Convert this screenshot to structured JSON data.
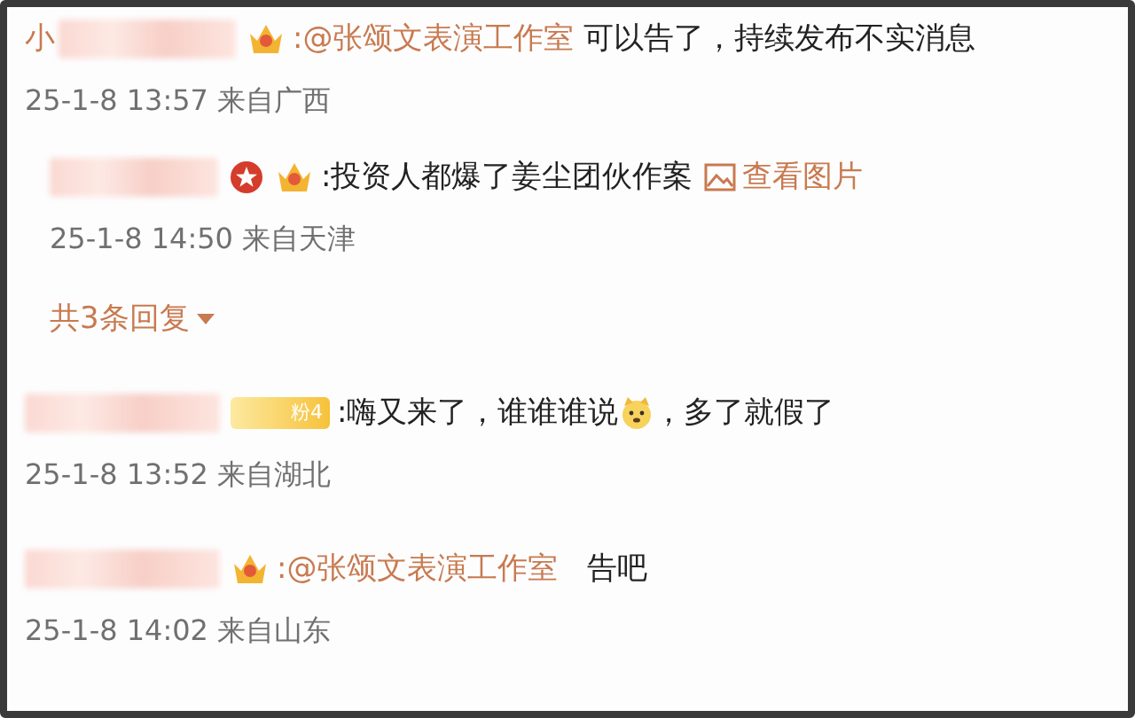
{
  "comments": [
    {
      "name_visible": "小",
      "badges": [
        {
          "kind": "crown"
        }
      ],
      "segments": [
        {
          "kind": "mention",
          "text": ":@张颂文表演工作室"
        },
        {
          "kind": "text",
          "text": " 可以告了，持续发布不实消息"
        }
      ],
      "meta": "25-1-8 13:57 来自广西",
      "replies": [
        {
          "badges": [
            {
              "kind": "star"
            },
            {
              "kind": "crown"
            }
          ],
          "segments": [
            {
              "kind": "text",
              "text": ":投资人都爆了姜尘团伙作案"
            },
            {
              "kind": "image_link",
              "text": "查看图片"
            }
          ],
          "meta": "25-1-8 14:50 来自天津"
        }
      ],
      "more_replies": "共3条回复"
    },
    {
      "badges": [
        {
          "kind": "fan",
          "label": "粉4"
        }
      ],
      "segments": [
        {
          "kind": "text",
          "text": ":嗨又来了，谁谁谁说"
        },
        {
          "kind": "emoji"
        },
        {
          "kind": "text",
          "text": "，多了就假了"
        }
      ],
      "meta": "25-1-8 13:52 来自湖北"
    },
    {
      "badges": [
        {
          "kind": "crown"
        }
      ],
      "segments": [
        {
          "kind": "mention",
          "text": ":@张颂文表演工作室"
        },
        {
          "kind": "text",
          "text": "   告吧"
        }
      ],
      "meta": "25-1-8 14:02 来自山东"
    }
  ]
}
